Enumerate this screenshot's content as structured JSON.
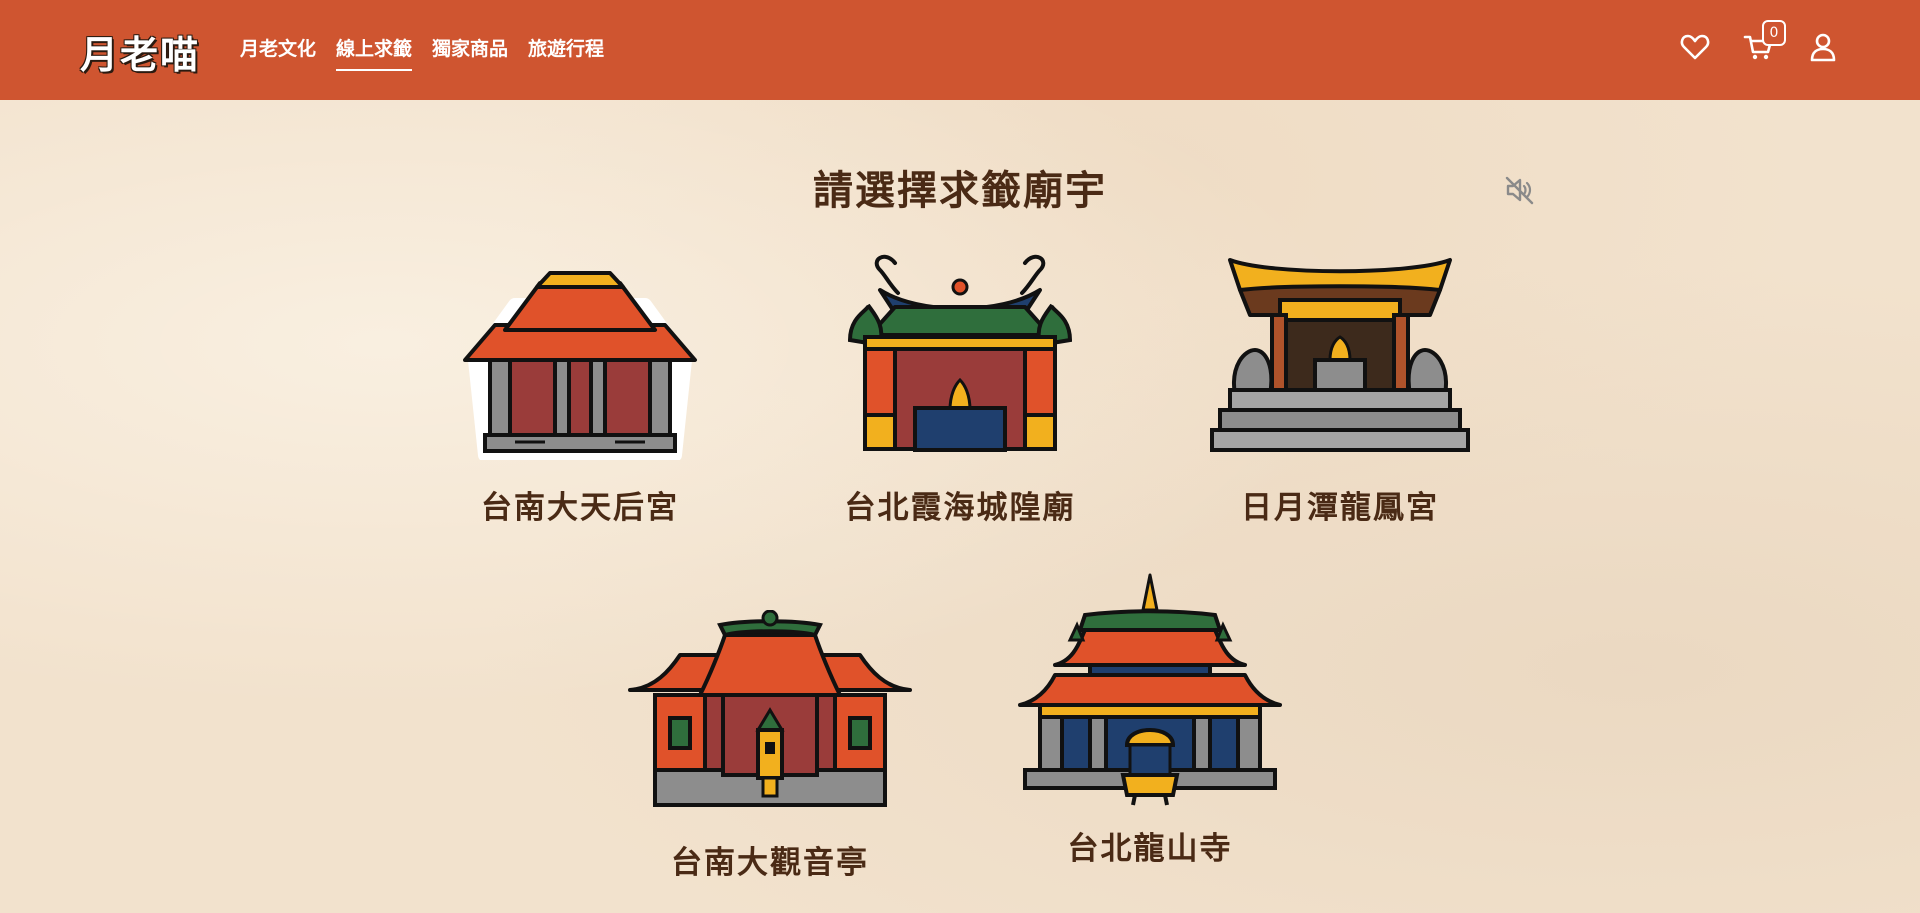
{
  "brand": {
    "logo_text": "月老喵"
  },
  "nav": {
    "items": [
      {
        "label": "月老文化",
        "active": false
      },
      {
        "label": "線上求籤",
        "active": true
      },
      {
        "label": "獨家商品",
        "active": false
      },
      {
        "label": "旅遊行程",
        "active": false
      }
    ],
    "icons": {
      "favorite": "heart-icon",
      "cart": "cart-icon",
      "account": "user-icon"
    },
    "cart_count": "0"
  },
  "page": {
    "title": "請選擇求籤廟宇",
    "sound_icon": "sound-muted-icon"
  },
  "temples": [
    {
      "label": "台南大天后宮"
    },
    {
      "label": "台北霞海城隍廟"
    },
    {
      "label": "日月潭龍鳳宮"
    },
    {
      "label": "台南大觀音亭"
    },
    {
      "label": "台北龍山寺"
    }
  ],
  "colors": {
    "header": "#cf5530",
    "background": "#f2e2cd",
    "text": "#4a2a15",
    "roof_red": "#e0522a",
    "wall_red": "#9a3c3a",
    "green": "#2f6e3c",
    "gold": "#f2b01e",
    "navy": "#1f3f6e",
    "stone": "#8d8d8d"
  }
}
